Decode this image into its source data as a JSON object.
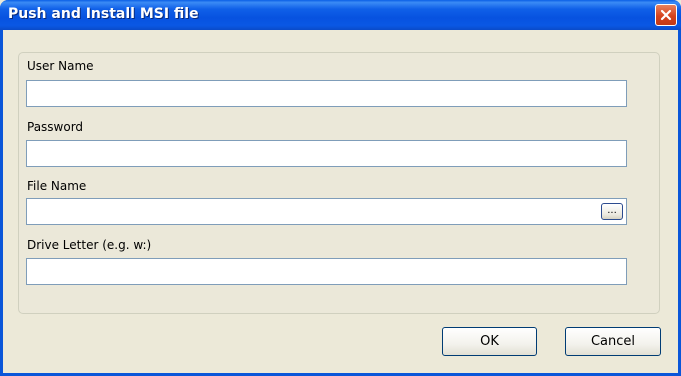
{
  "window": {
    "title": "Push and Install MSI file",
    "close_icon": "close-x-icon",
    "colors": {
      "titlebar": "#0752e0",
      "close": "#d6431e",
      "dialog_bg": "#ece9d8",
      "input_border": "#7f9db9"
    }
  },
  "form": {
    "user_name_label": "User Name",
    "user_name_value": "",
    "password_label": "Password",
    "password_value": "",
    "file_name_label": "File Name",
    "file_name_value": "",
    "browse_label": "...",
    "drive_letter_label": "Drive Letter (e.g. w:)",
    "drive_letter_value": ""
  },
  "buttons": {
    "ok_label": "OK",
    "cancel_label": "Cancel"
  }
}
